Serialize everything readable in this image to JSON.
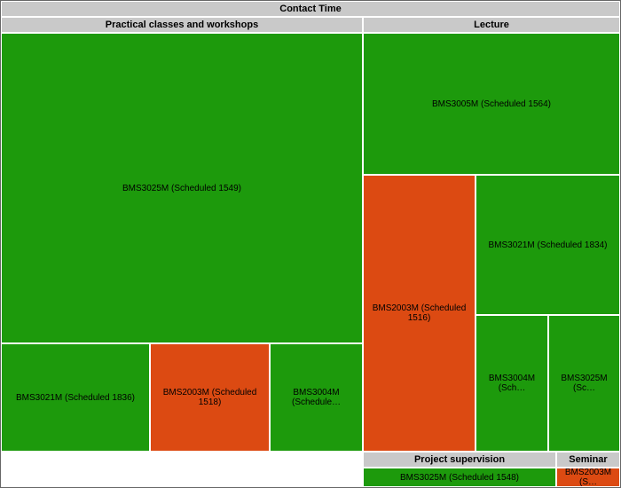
{
  "title": "Contact Time",
  "colors": {
    "green": "#1d9a0c",
    "orange": "#dc4a12",
    "header": "#c9c9c9"
  },
  "categories": {
    "practical": {
      "label": "Practical classes and workshops",
      "cells": {
        "c1": {
          "label": "BMS3025M (Scheduled 1549)",
          "code": "BMS3025M",
          "scheduled": 1549,
          "color": "green"
        },
        "c2": {
          "label": "BMS3021M (Scheduled 1836)",
          "code": "BMS3021M",
          "scheduled": 1836,
          "color": "green"
        },
        "c3": {
          "label": "BMS2003M (Scheduled 1518)",
          "code": "BMS2003M",
          "scheduled": 1518,
          "color": "orange"
        },
        "c4": {
          "label": "BMS3004M (Schedule…",
          "code": "BMS3004M",
          "scheduled": null,
          "color": "green"
        }
      }
    },
    "lecture": {
      "label": "Lecture",
      "cells": {
        "c1": {
          "label": "BMS3005M (Scheduled 1564)",
          "code": "BMS3005M",
          "scheduled": 1564,
          "color": "green"
        },
        "c2": {
          "label": "BMS2003M (Scheduled 1516)",
          "code": "BMS2003M",
          "scheduled": 1516,
          "color": "orange"
        },
        "c3": {
          "label": "BMS3021M (Scheduled 1834)",
          "code": "BMS3021M",
          "scheduled": 1834,
          "color": "green"
        },
        "c4": {
          "label": "BMS3004M (Sch…",
          "code": "BMS3004M",
          "scheduled": null,
          "color": "green"
        },
        "c5": {
          "label": "BMS3025M (Sc…",
          "code": "BMS3025M",
          "scheduled": null,
          "color": "green"
        }
      }
    },
    "project": {
      "label": "Project supervision",
      "cells": {
        "c1": {
          "label": "BMS3025M (Scheduled 1548)",
          "code": "BMS3025M",
          "scheduled": 1548,
          "color": "green"
        }
      }
    },
    "seminar": {
      "label": "Seminar",
      "cells": {
        "c1": {
          "label": "BMS2003M (S…",
          "code": "BMS2003M",
          "scheduled": null,
          "color": "orange"
        }
      }
    }
  },
  "chart_data": {
    "type": "treemap",
    "title": "Contact Time",
    "groups": [
      {
        "name": "Practical classes and workshops",
        "children": [
          {
            "name": "BMS3025M (Scheduled 1549)",
            "value": 1549,
            "color": "green"
          },
          {
            "name": "BMS3021M (Scheduled 1836)",
            "value": 1836,
            "color": "green"
          },
          {
            "name": "BMS2003M (Scheduled 1518)",
            "value": 1518,
            "color": "orange"
          },
          {
            "name": "BMS3004M",
            "value": null,
            "color": "green"
          }
        ]
      },
      {
        "name": "Lecture",
        "children": [
          {
            "name": "BMS3005M (Scheduled 1564)",
            "value": 1564,
            "color": "green"
          },
          {
            "name": "BMS2003M (Scheduled 1516)",
            "value": 1516,
            "color": "orange"
          },
          {
            "name": "BMS3021M (Scheduled 1834)",
            "value": 1834,
            "color": "green"
          },
          {
            "name": "BMS3004M",
            "value": null,
            "color": "green"
          },
          {
            "name": "BMS3025M",
            "value": null,
            "color": "green"
          }
        ]
      },
      {
        "name": "Project supervision",
        "children": [
          {
            "name": "BMS3025M (Scheduled 1548)",
            "value": 1548,
            "color": "green"
          }
        ]
      },
      {
        "name": "Seminar",
        "children": [
          {
            "name": "BMS2003M",
            "value": null,
            "color": "orange"
          }
        ]
      }
    ]
  }
}
